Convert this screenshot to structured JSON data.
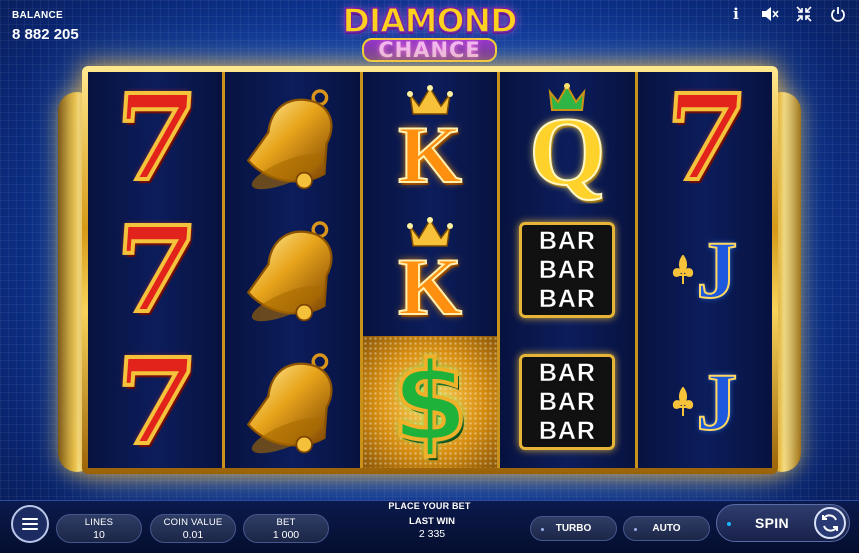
{
  "balance": {
    "label": "BALANCE",
    "value": "8 882 205"
  },
  "logo": {
    "line1": "DIAMOND",
    "line2": "CHANCE"
  },
  "top_icons": [
    "info-icon",
    "mute-icon",
    "fullscreen-icon",
    "power-icon"
  ],
  "top_icon_glyphs": {
    "info": "i"
  },
  "reels": [
    [
      "seven",
      "seven",
      "seven"
    ],
    [
      "bell",
      "bell",
      "bell"
    ],
    [
      "king",
      "king",
      "dollar"
    ],
    [
      "queen",
      "bar",
      "bar"
    ],
    [
      "seven",
      "jack",
      "jack"
    ]
  ],
  "symbols": {
    "seven": "7",
    "king": "K",
    "queen": "Q",
    "jack": "J",
    "dollar": "$",
    "bar": [
      "BAR",
      "BAR",
      "BAR"
    ]
  },
  "controls": {
    "prompt": "PLACE YOUR BET",
    "lines": {
      "label": "LINES",
      "value": "10"
    },
    "coin_value": {
      "label": "COIN VALUE",
      "value": "0.01"
    },
    "bet": {
      "label": "BET",
      "value": "1 000"
    },
    "last_win": {
      "label": "LAST WIN",
      "value": "2 335"
    },
    "turbo": "TURBO",
    "auto": "AUTO",
    "spin": "SPIN"
  },
  "colors": {
    "background": "#0f3a9e",
    "frame_gold": "#d69a17",
    "seven_red": "#e1231c",
    "dollar_green": "#1fb23a"
  }
}
